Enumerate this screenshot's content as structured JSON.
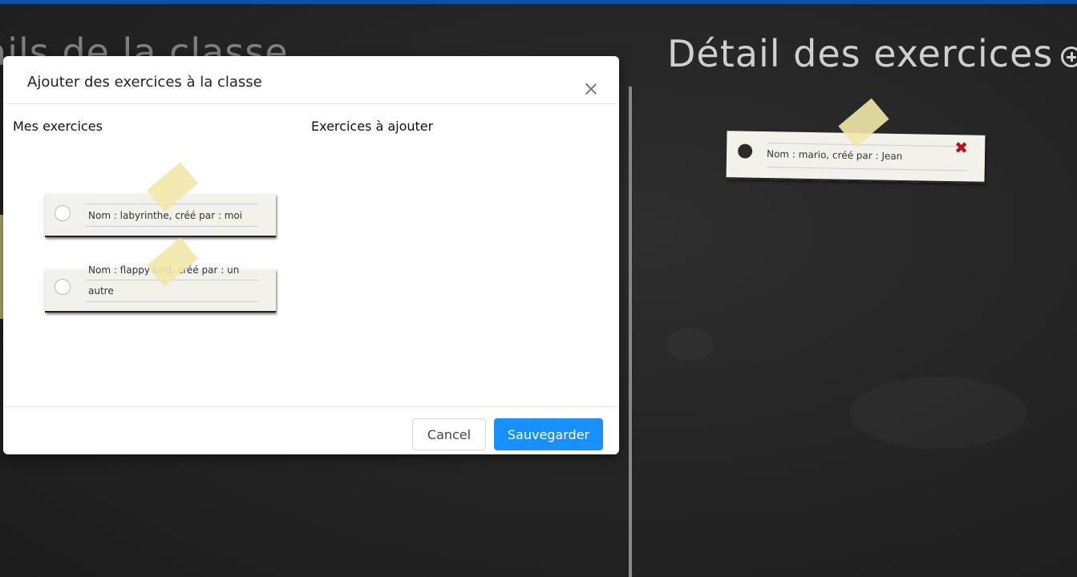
{
  "background": {
    "left_title": "ails de la classe",
    "right_title": "Détail des exercices",
    "add_exercise_icon": "plus-circle-icon",
    "class_exercises": [
      {
        "text": "Nom : mario, créé par : Jean",
        "delete_icon": "close-x-icon",
        "delete_symbol": "✖"
      }
    ]
  },
  "modal": {
    "title": "Ajouter des exercices à la classe",
    "close_icon": "close-icon",
    "my_exercises_heading": "Mes exercices",
    "to_add_heading": "Exercices à ajouter",
    "my_exercises": [
      {
        "text": "Nom : labyrinthe, créé par : moi"
      },
      {
        "text_line1": "Nom : flappy bird, créé par : un",
        "text_line2": "autre"
      }
    ],
    "exercises_to_add": [],
    "cancel_label": "Cancel",
    "save_label": "Sauvegarder"
  },
  "colors": {
    "chalkboard": "#262626",
    "top_bar": "#0f4fa8",
    "primary_button": "#1890ff",
    "delete": "#b3121b",
    "tape": "#f2e8aa"
  }
}
